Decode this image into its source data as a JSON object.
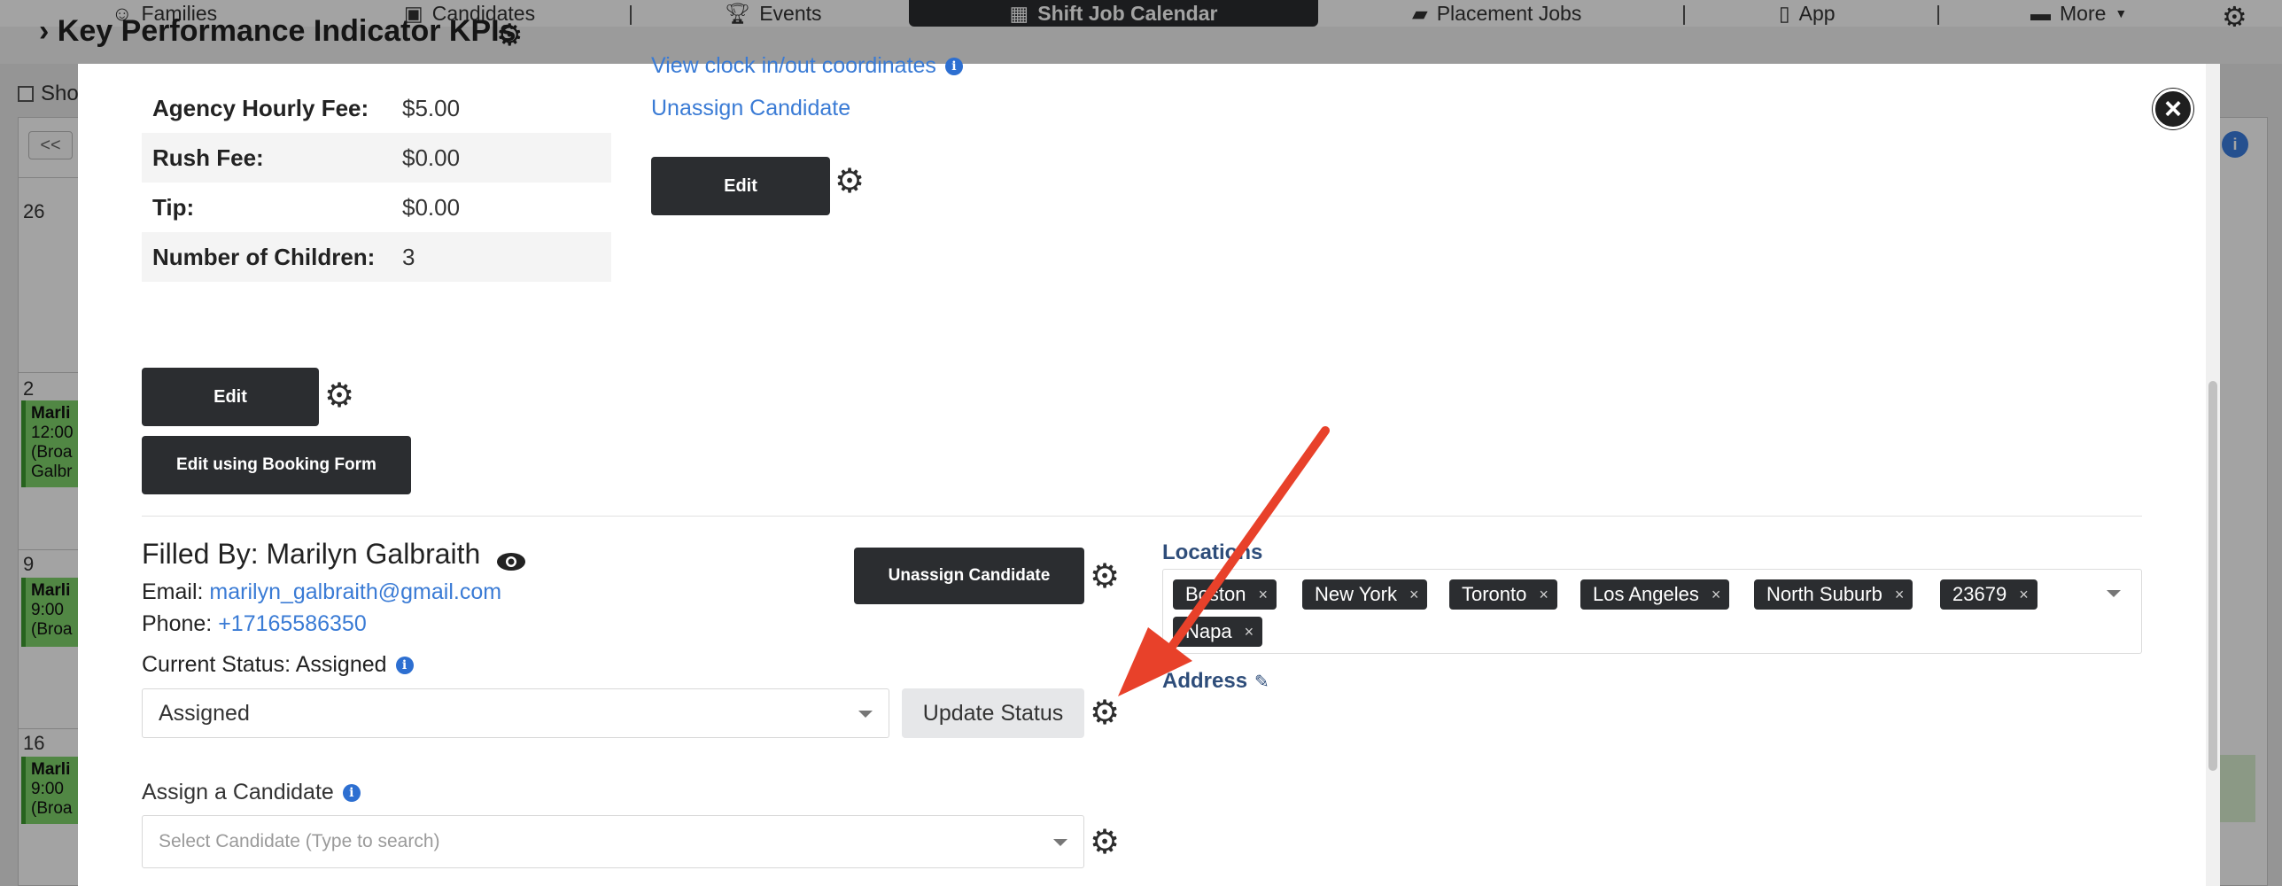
{
  "nav": {
    "items": [
      {
        "label": "Families",
        "icon": "smiley-icon"
      },
      {
        "label": "Candidates",
        "icon": "briefcase-user-icon"
      },
      {
        "label": "Events",
        "icon": "trophy-icon"
      },
      {
        "label": "Shift Job Calendar",
        "icon": "calendar-icon",
        "active": true
      },
      {
        "label": "Placement Jobs",
        "icon": "briefcase-icon"
      },
      {
        "label": "App",
        "icon": "mobile-icon"
      },
      {
        "label": "More",
        "icon": "chat-icon"
      }
    ],
    "settings_icon": "gear-icon"
  },
  "background": {
    "kpi_title": "› Key Performance Indicator KPIs",
    "checkbox_label": "Sho",
    "prev_label": "<<",
    "days": [
      "26",
      "2",
      "9",
      "16"
    ],
    "events": [
      {
        "name": "Marli",
        "time": "12:00",
        "place": "(Broa",
        "extra": "Galbr"
      },
      {
        "name": "Marli",
        "time": "9:00 ",
        "place": "(Broa"
      },
      {
        "name": "Marli",
        "time": "9:00 ",
        "place": "(Broa"
      }
    ]
  },
  "fees": [
    {
      "label": "Agency Hourly Fee:",
      "value": "$5.00"
    },
    {
      "label": "Rush Fee:",
      "value": "$0.00"
    },
    {
      "label": "Tip:",
      "value": "$0.00"
    },
    {
      "label": "Number of Children:",
      "value": "3"
    }
  ],
  "links": {
    "clock_coords": "View clock in/out coordinates",
    "unassign": "Unassign Candidate"
  },
  "buttons": {
    "edit": "Edit",
    "edit_booking": "Edit using Booking Form",
    "unassign_candidate": "Unassign Candidate",
    "update_status": "Update Status"
  },
  "filled": {
    "title": "Filled By: Marilyn Galbraith",
    "email_label": "Email: ",
    "email": "marilyn_galbraith@gmail.com",
    "phone_label": "Phone: ",
    "phone": "+17165586350",
    "status_text": "Current Status: Assigned",
    "status_value": "Assigned"
  },
  "assign": {
    "label": "Assign a Candidate",
    "placeholder": "Select Candidate (Type to search)"
  },
  "locations": {
    "label": "Locations",
    "tags": [
      "Boston",
      "New York",
      "Toronto",
      "Los Angeles",
      "North Suburb",
      "23679",
      "Napa"
    ],
    "address_label": "Address"
  },
  "annotation": {
    "arrow_color": "#e8412a"
  }
}
